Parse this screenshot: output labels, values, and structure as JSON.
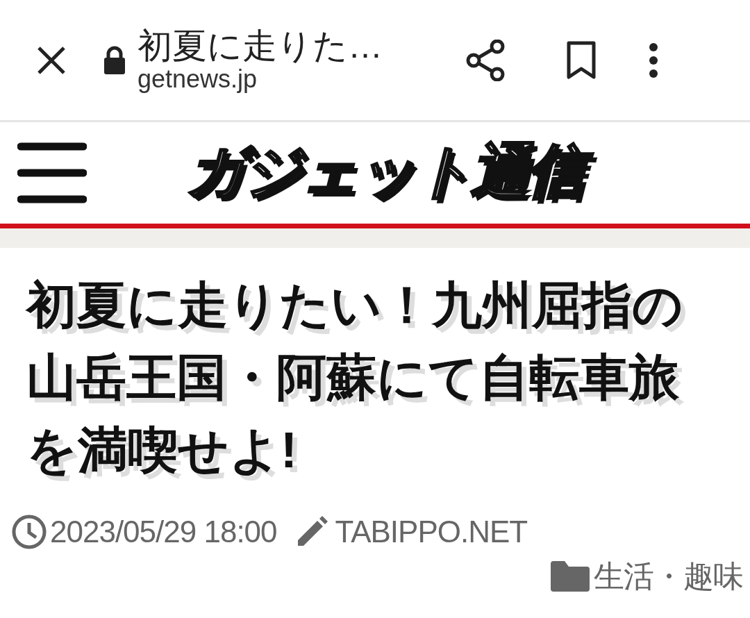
{
  "browser": {
    "title": "初夏に走りた…",
    "url": "getnews.jp"
  },
  "site": {
    "logo": "ガジェット通信"
  },
  "article": {
    "title": "初夏に走りたい！九州屈指の山岳王国・阿蘇にて自転車旅を満喫せよ!",
    "date": "2023/05/29 18:00",
    "author": "TABIPPO.NET",
    "category": "生活・趣味"
  }
}
